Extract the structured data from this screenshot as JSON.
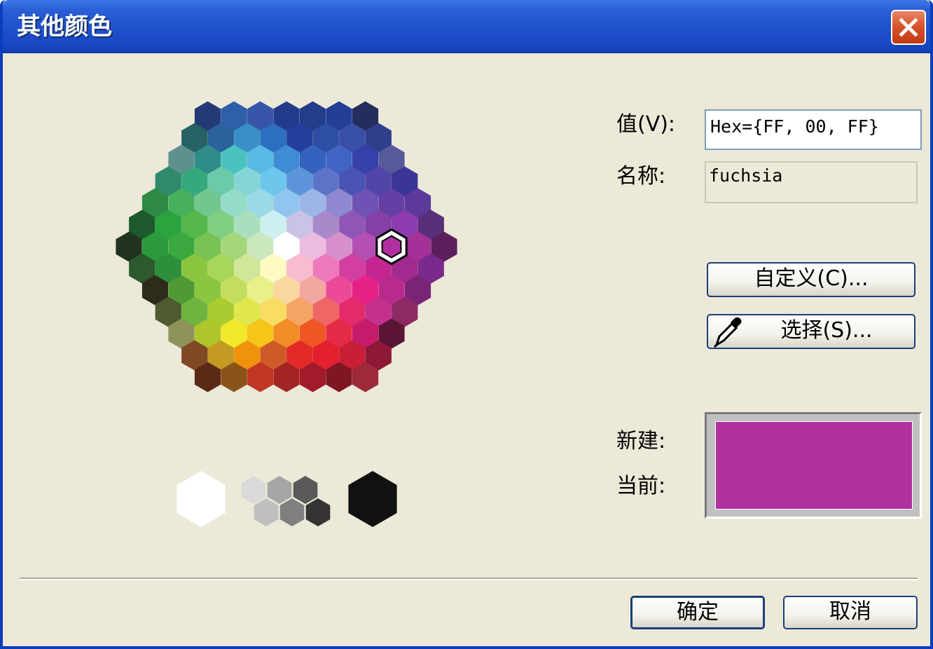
{
  "window": {
    "title": "其他颜色"
  },
  "icons": {
    "close": "close-icon",
    "eyedropper": "eyedropper-icon"
  },
  "palette": {
    "rows": [
      [
        "#233a77",
        "#2e5fa8",
        "#3755a8",
        "#243a8b",
        "#233d8a",
        "#233e95",
        "#232e5d"
      ],
      [
        "#266163",
        "#2a639a",
        "#3a8fc6",
        "#2c6ec0",
        "#243f9b",
        "#2e4ea3",
        "#3a50a8",
        "#2f3f8c"
      ],
      [
        "#5e9090",
        "#2e8d8a",
        "#4ac3c0",
        "#58b9e3",
        "#3f8bd4",
        "#3562bf",
        "#3f64c4",
        "#3541a8",
        "#575a9a"
      ],
      [
        "#2f8a6c",
        "#36a97c",
        "#6bcaa8",
        "#85d4d6",
        "#6dc7ec",
        "#5b94d8",
        "#5d73c8",
        "#4a53b4",
        "#5245a8",
        "#3a3596"
      ],
      [
        "#2e8a45",
        "#46b05d",
        "#73c78e",
        "#94dcc8",
        "#9ad9e6",
        "#8fc5ee",
        "#9cb5e6",
        "#8d88cf",
        "#6f53b4",
        "#6540a4",
        "#5c3a9c"
      ],
      [
        "#1d5a2d",
        "#2aa43f",
        "#54b84c",
        "#80cf82",
        "#a9dfbf",
        "#cdefef",
        "#c9c3e5",
        "#a789c9",
        "#8f56b7",
        "#8540a8",
        "#8e3bb0",
        "#5a2f7a"
      ],
      [
        "#203321",
        "#2b9a3d",
        "#3aa83f",
        "#77c253",
        "#a6d67a",
        "#cae7be",
        "#ffffff",
        "#ecbce0",
        "#d590cc",
        "#b44fb4",
        "#b02f9f",
        "#a43098",
        "#5c1e5c"
      ],
      [
        "#2c5a2c",
        "#2d8e3c",
        "#8cc63f",
        "#a6d65a",
        "#d0e79a",
        "#fffac2",
        "#f8bcd0",
        "#ee79bd",
        "#d33fa0",
        "#c32690",
        "#a02a8e",
        "#7a2a8c"
      ],
      [
        "#2e2b1a",
        "#4f9a34",
        "#8cc63f",
        "#c3de5e",
        "#eaf089",
        "#fad7a0",
        "#f2a7a0",
        "#ec4a98",
        "#e72186",
        "#b82b8c",
        "#7a2478"
      ],
      [
        "#4f5a30",
        "#6eb43f",
        "#abcc31",
        "#e0e74e",
        "#f9dc62",
        "#f5a468",
        "#ee6666",
        "#e42b6b",
        "#c3308e",
        "#8d2a64"
      ],
      [
        "#8f935a",
        "#b0c52c",
        "#f1e82a",
        "#f5c619",
        "#f38b26",
        "#ee5624",
        "#e62a4a",
        "#c51b6a",
        "#5a1535"
      ],
      [
        "#7f4a23",
        "#c39a22",
        "#f1920d",
        "#ce5b27",
        "#e42929",
        "#e41f2e",
        "#c81f36",
        "#8e1838"
      ],
      [
        "#5a2a17",
        "#8a5419",
        "#c23626",
        "#a42424",
        "#a21b2b",
        "#7e1722",
        "#9d2a3a"
      ]
    ],
    "grays": {
      "white": "#ffffff",
      "light": [
        "#d9d9d9",
        "#a6a6a6",
        "#595959",
        "#bfbfbf",
        "#7f7f7f",
        "#333333"
      ],
      "black": "#111111"
    },
    "selected_color": "#b030a0"
  },
  "value_label": "值(V):",
  "value_field": "Hex={FF, 00, FF}",
  "name_label": "名称:",
  "name_field": "fuchsia",
  "custom_button": "自定义(C)...",
  "pick_button": "选择(S)...",
  "new_label": "新建:",
  "current_label": "当前:",
  "colors": {
    "new": "#b030a0",
    "current": "#b030a0"
  },
  "ok_button": "确定",
  "cancel_button": "取消"
}
